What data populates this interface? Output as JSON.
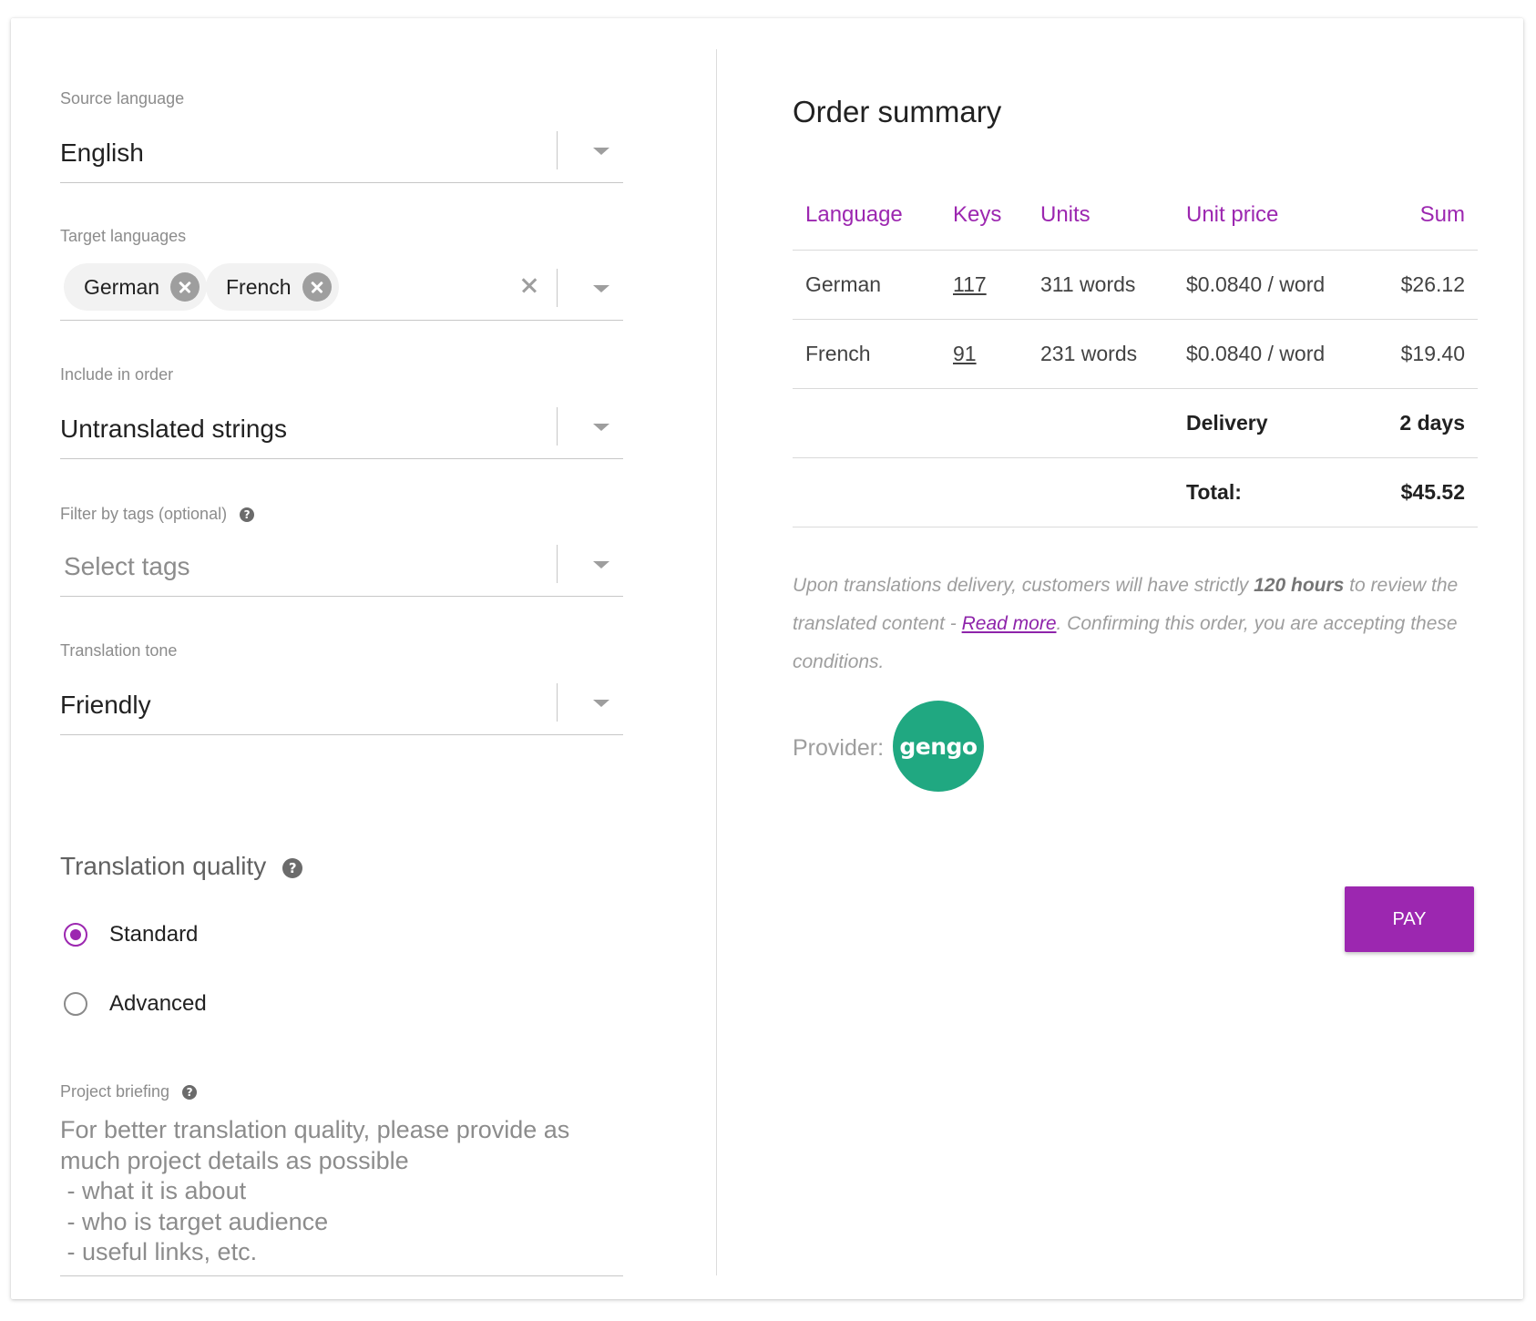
{
  "form": {
    "source_language": {
      "label": "Source language",
      "value": "English"
    },
    "target_languages": {
      "label": "Target languages",
      "chips": [
        {
          "label": "German"
        },
        {
          "label": "French"
        }
      ]
    },
    "include_in_order": {
      "label": "Include in order",
      "value": "Untranslated strings"
    },
    "filter_tags": {
      "label": "Filter by tags (optional)",
      "placeholder": "Select tags"
    },
    "translation_tone": {
      "label": "Translation tone",
      "value": "Friendly"
    },
    "translation_quality": {
      "title": "Translation quality",
      "options": [
        {
          "label": "Standard",
          "selected": true
        },
        {
          "label": "Advanced",
          "selected": false
        }
      ]
    },
    "project_briefing": {
      "label": "Project briefing",
      "placeholder_lines": [
        "For better translation quality, please provide as",
        "much project details as possible",
        " - what it is about",
        " - who is target audience",
        " - useful links, etc."
      ]
    },
    "help_icon_glyph": "?"
  },
  "summary": {
    "title": "Order summary",
    "columns": {
      "language": "Language",
      "keys": "Keys",
      "units": "Units",
      "unit_price": "Unit price",
      "sum": "Sum"
    },
    "rows": [
      {
        "language": "German",
        "keys": "117",
        "units": "311 words",
        "unit_price": "$0.0840 / word",
        "sum": "$26.12"
      },
      {
        "language": "French",
        "keys": "91",
        "units": "231 words",
        "unit_price": "$0.0840 / word",
        "sum": "$19.40"
      }
    ],
    "delivery": {
      "label": "Delivery",
      "value": "2 days"
    },
    "total": {
      "label": "Total:",
      "value": "$45.52"
    },
    "notice": {
      "text_before": "Upon translations delivery, customers will have strictly ",
      "bold": "120 hours",
      "text_mid": " to review the translated content - ",
      "link": "Read more",
      "text_after": ". Confirming this order, you are accepting these conditions."
    },
    "provider_label": "Provider:",
    "provider_logo_text": "gengo",
    "pay_label": "PAY"
  },
  "colors": {
    "accent": "#9c27b0",
    "provider_green": "#20a881",
    "label_gray": "#8c8c8c"
  }
}
